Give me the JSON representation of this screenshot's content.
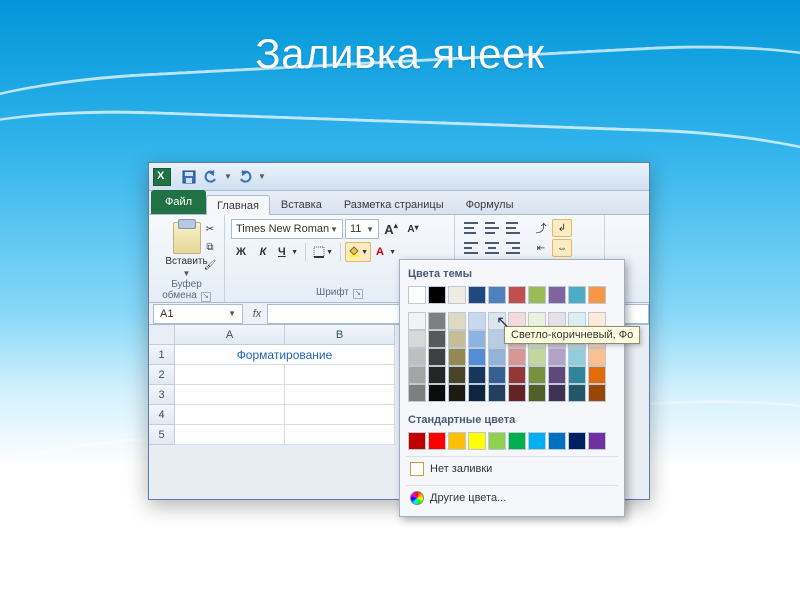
{
  "slide": {
    "title": "Заливка ячеек"
  },
  "qat": {
    "save_tip": "Сохранить",
    "undo_tip": "Отменить",
    "redo_tip": "Вернуть"
  },
  "tabs": {
    "file": "Файл",
    "items": [
      "Главная",
      "Вставка",
      "Разметка страницы",
      "Формулы"
    ],
    "active_index": 0
  },
  "ribbon": {
    "clipboard": {
      "paste": "Вставить",
      "group_label": "Буфер обмена"
    },
    "font": {
      "name": "Times New Roman",
      "size": "11",
      "grow_tip": "A",
      "shrink_tip": "A",
      "bold": "Ж",
      "italic": "К",
      "underline": "Ч",
      "group_label": "Шрифт"
    },
    "alignment": {
      "group_label": ""
    }
  },
  "formula_bar": {
    "name_box": "A1",
    "fx": "fx"
  },
  "grid": {
    "columns": [
      "A",
      "B"
    ],
    "rows": [
      "1",
      "2",
      "3",
      "4",
      "5"
    ],
    "a1_value": "Форматирование"
  },
  "color_picker": {
    "theme_label": "Цвета темы",
    "standard_label": "Стандартные цвета",
    "no_fill": "Нет заливки",
    "more_colors": "Другие цвета...",
    "tooltip": "Светло-коричневый, Фо",
    "theme_row": [
      "#ffffff",
      "#000000",
      "#eeece1",
      "#1f497d",
      "#4f81bd",
      "#c0504d",
      "#9bbb59",
      "#8064a2",
      "#4bacc6",
      "#f79646"
    ],
    "theme_shades": [
      [
        "#f2f2f2",
        "#7f7f7f",
        "#ddd9c3",
        "#c6d9f0",
        "#dbe5f1",
        "#f2dcdb",
        "#ebf1dd",
        "#e5e0ec",
        "#dbeef3",
        "#fdeada"
      ],
      [
        "#d8d8d8",
        "#595959",
        "#c4bd97",
        "#8db3e2",
        "#b8cce4",
        "#e5b9b7",
        "#d7e3bc",
        "#ccc1d9",
        "#b7dde8",
        "#fbd5b5"
      ],
      [
        "#bfbfbf",
        "#3f3f3f",
        "#938953",
        "#548dd4",
        "#95b3d7",
        "#d99694",
        "#c3d69b",
        "#b2a2c7",
        "#92cddc",
        "#fac08f"
      ],
      [
        "#a5a5a5",
        "#262626",
        "#494429",
        "#17365d",
        "#366092",
        "#953734",
        "#76923c",
        "#5f497a",
        "#31859b",
        "#e36c09"
      ],
      [
        "#7f7f7f",
        "#0c0c0c",
        "#1d1b10",
        "#0f243e",
        "#244061",
        "#632423",
        "#4f6128",
        "#3f3151",
        "#205867",
        "#974806"
      ]
    ],
    "standard_row": [
      "#c00000",
      "#ff0000",
      "#ffc000",
      "#ffff00",
      "#92d050",
      "#00b050",
      "#00b0f0",
      "#0070c0",
      "#002060",
      "#7030a0"
    ]
  }
}
